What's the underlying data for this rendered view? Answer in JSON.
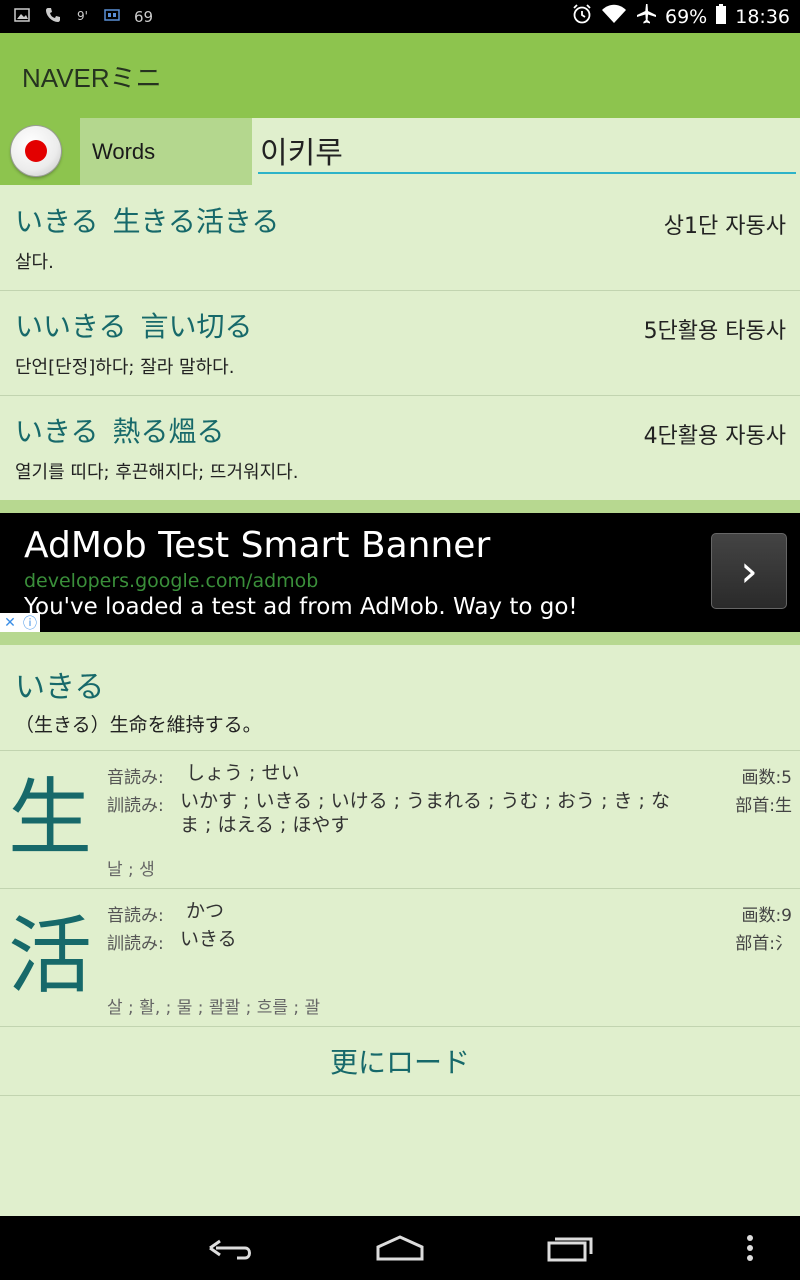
{
  "status_bar": {
    "left_value": "69",
    "battery": "69%",
    "time": "18:36",
    "left_icons": [
      "image-icon",
      "phone-icon",
      "signal-icon",
      "cast-icon"
    ],
    "right_icons": [
      "alarm-icon",
      "wifi-icon",
      "airplane-icon",
      "battery-icon"
    ]
  },
  "app": {
    "title": "NAVERミニ"
  },
  "search": {
    "mode_label": "Words",
    "query": "이키루"
  },
  "results": [
    {
      "reading": "いきる",
      "kanji": "生きる活きる",
      "pos": "상1단 자동사",
      "definition": "살다."
    },
    {
      "reading": "いいきる",
      "kanji": "言い切る",
      "pos": "5단활용 타동사",
      "definition": "단언[단정]하다; 잘라 말하다."
    },
    {
      "reading": "いきる",
      "kanji": "熱る熅る",
      "pos": "4단활용 자동사",
      "definition": "열기를 띠다; 후끈해지다; 뜨거워지다."
    }
  ],
  "ad": {
    "title": "AdMob Test Smart Banner",
    "url": "developers.google.com/admob",
    "text": "You've loaded a test ad from AdMob. Way to go!",
    "arrow": "›"
  },
  "detail": {
    "reading": "いきる",
    "meaning": "（生きる）生命を維持する。",
    "kanji": [
      {
        "char": "生",
        "on_label": "音読み:",
        "on": "しょう ; せい",
        "kun_label": "訓読み:",
        "kun": "いかす ; いきる ; いける ; うまれる ; うむ ; おう ; き ; なま ; はえる ; ほやす",
        "strokes": "画数:5",
        "radical": "部首:生",
        "korean": "날 ; 생"
      },
      {
        "char": "活",
        "on_label": "音読み:",
        "on": "かつ",
        "kun_label": "訓読み:",
        "kun": "いきる",
        "strokes": "画数:9",
        "radical": "部首:氵",
        "korean": "살 ; 활, ; 물 ; 콸콸 ; 흐를 ; 괄"
      }
    ],
    "load_more": "更にロード"
  },
  "nav": {
    "icons": [
      "back-icon",
      "home-icon",
      "recents-icon",
      "menu-icon"
    ]
  }
}
